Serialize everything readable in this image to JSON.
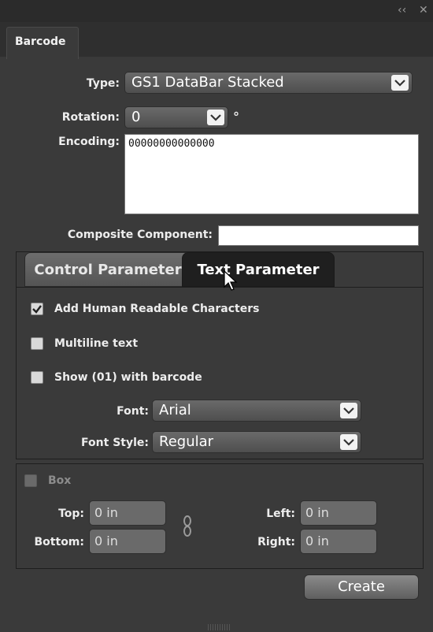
{
  "window": {
    "collapse_glyph": "‹‹",
    "close_glyph": "✕"
  },
  "panel_tab": "Barcode",
  "form": {
    "type_label": "Type:",
    "type_value": "GS1 DataBar Stacked",
    "rotation_label": "Rotation:",
    "rotation_value": "0",
    "degree_symbol": "°",
    "encoding_label": "Encoding:",
    "encoding_value": "00000000000000",
    "composite_label": "Composite Component:",
    "composite_value": ""
  },
  "subtabs": {
    "control": "Control Parameter",
    "text": "Text Parameter"
  },
  "text_params": {
    "human_readable_label": "Add Human Readable Characters",
    "human_readable_checked": true,
    "multiline_label": "Multiline text",
    "multiline_checked": false,
    "show01_label": "Show (01) with barcode",
    "show01_checked": false,
    "font_label": "Font:",
    "font_value": "Arial",
    "font_style_label": "Font Style:",
    "font_style_value": "Regular"
  },
  "box": {
    "label": "Box",
    "checked": false,
    "top_label": "Top:",
    "top_value": "0 in",
    "bottom_label": "Bottom:",
    "bottom_value": "0 in",
    "left_label": "Left:",
    "left_value": "0 in",
    "right_label": "Right:",
    "right_value": "0 in"
  },
  "actions": {
    "create_label": "Create"
  },
  "icons": {
    "chevron": "chevron-down-icon",
    "link": "chain-link-icon",
    "cursor": "mouse-pointer-icon"
  }
}
